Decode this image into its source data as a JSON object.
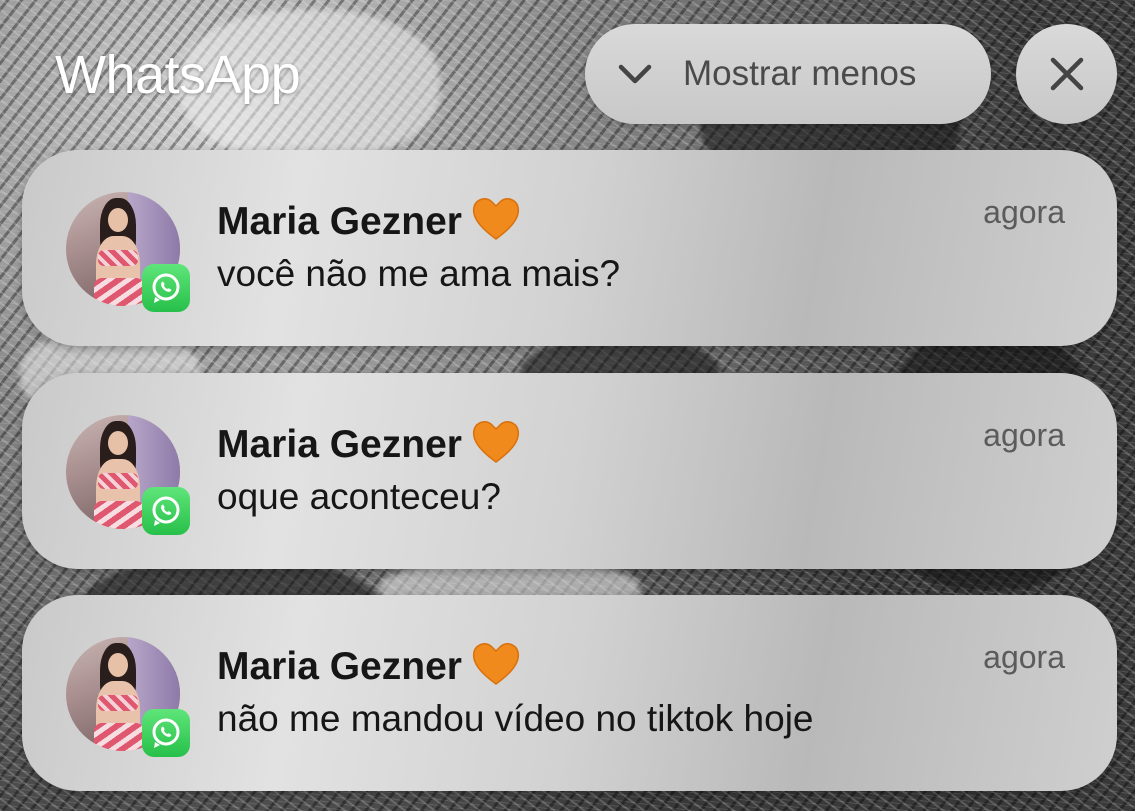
{
  "app": {
    "title": "WhatsApp"
  },
  "controls": {
    "show_less_label": "Mostrar menos",
    "show_less_icon": "chevron-down-icon",
    "close_icon": "close-icon"
  },
  "notifications": [
    {
      "sender": "Maria Gezner",
      "sender_emoji": "orange-heart-icon",
      "time": "agora",
      "message": "você não me ama mais?"
    },
    {
      "sender": "Maria Gezner",
      "sender_emoji": "orange-heart-icon",
      "time": "agora",
      "message": "oque aconteceu?"
    },
    {
      "sender": "Maria Gezner",
      "sender_emoji": "orange-heart-icon",
      "time": "agora",
      "message": "não me mandou vídeo no tiktok hoje"
    }
  ],
  "colors": {
    "whatsapp_green": "#27c04a",
    "heart_orange": "#f08a1c"
  }
}
